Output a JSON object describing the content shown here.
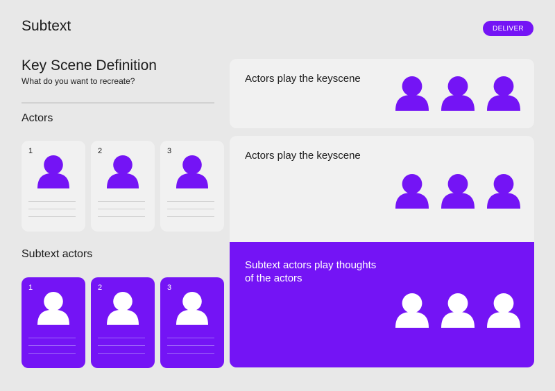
{
  "header": {
    "title": "Subtext",
    "deliver_label": "DELIVER"
  },
  "definition": {
    "title": "Key Scene Definition",
    "subtitle": "What do you want to recreate?"
  },
  "actors": {
    "label": "Actors",
    "cards": [
      {
        "number": "1"
      },
      {
        "number": "2"
      },
      {
        "number": "3"
      }
    ]
  },
  "subtext_actors": {
    "label": "Subtext actors",
    "cards": [
      {
        "number": "1"
      },
      {
        "number": "2"
      },
      {
        "number": "3"
      }
    ]
  },
  "panels": {
    "top": {
      "text": "Actors play the keyscene"
    },
    "middle": {
      "text": "Actors play the keyscene"
    },
    "bottom": {
      "line1": "Subtext actors play thoughts",
      "line2": "of the actors"
    }
  },
  "colors": {
    "accent": "#7414f5",
    "background": "#e8e8e8",
    "card": "#f1f1f1"
  },
  "icons": {
    "figure": "person-icon"
  }
}
